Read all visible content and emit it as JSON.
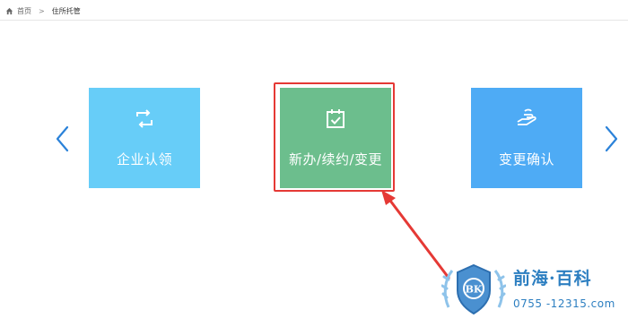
{
  "breadcrumb": {
    "home_label": "首页",
    "separator": ">",
    "current": "住所托管"
  },
  "cards": [
    {
      "label": "企业认领",
      "icon": "refresh-icon",
      "color": "#67cdf8"
    },
    {
      "label": "新办/续约/变更",
      "icon": "calendar-check-icon",
      "color": "#6cbe8d"
    },
    {
      "label": "变更确认",
      "icon": "hand-holding-icon",
      "color": "#4eabf5"
    }
  ],
  "nav": {
    "prev_icon": "chevron-left-icon",
    "next_icon": "chevron-right-icon",
    "arrow_color": "#2b82d9"
  },
  "annotation": {
    "color": "#e53935",
    "highlighted_card": "新办/续约/变更"
  },
  "watermark": {
    "seal_letters": "BK",
    "name": "前海·百科",
    "phone": "0755 -12315.com"
  }
}
